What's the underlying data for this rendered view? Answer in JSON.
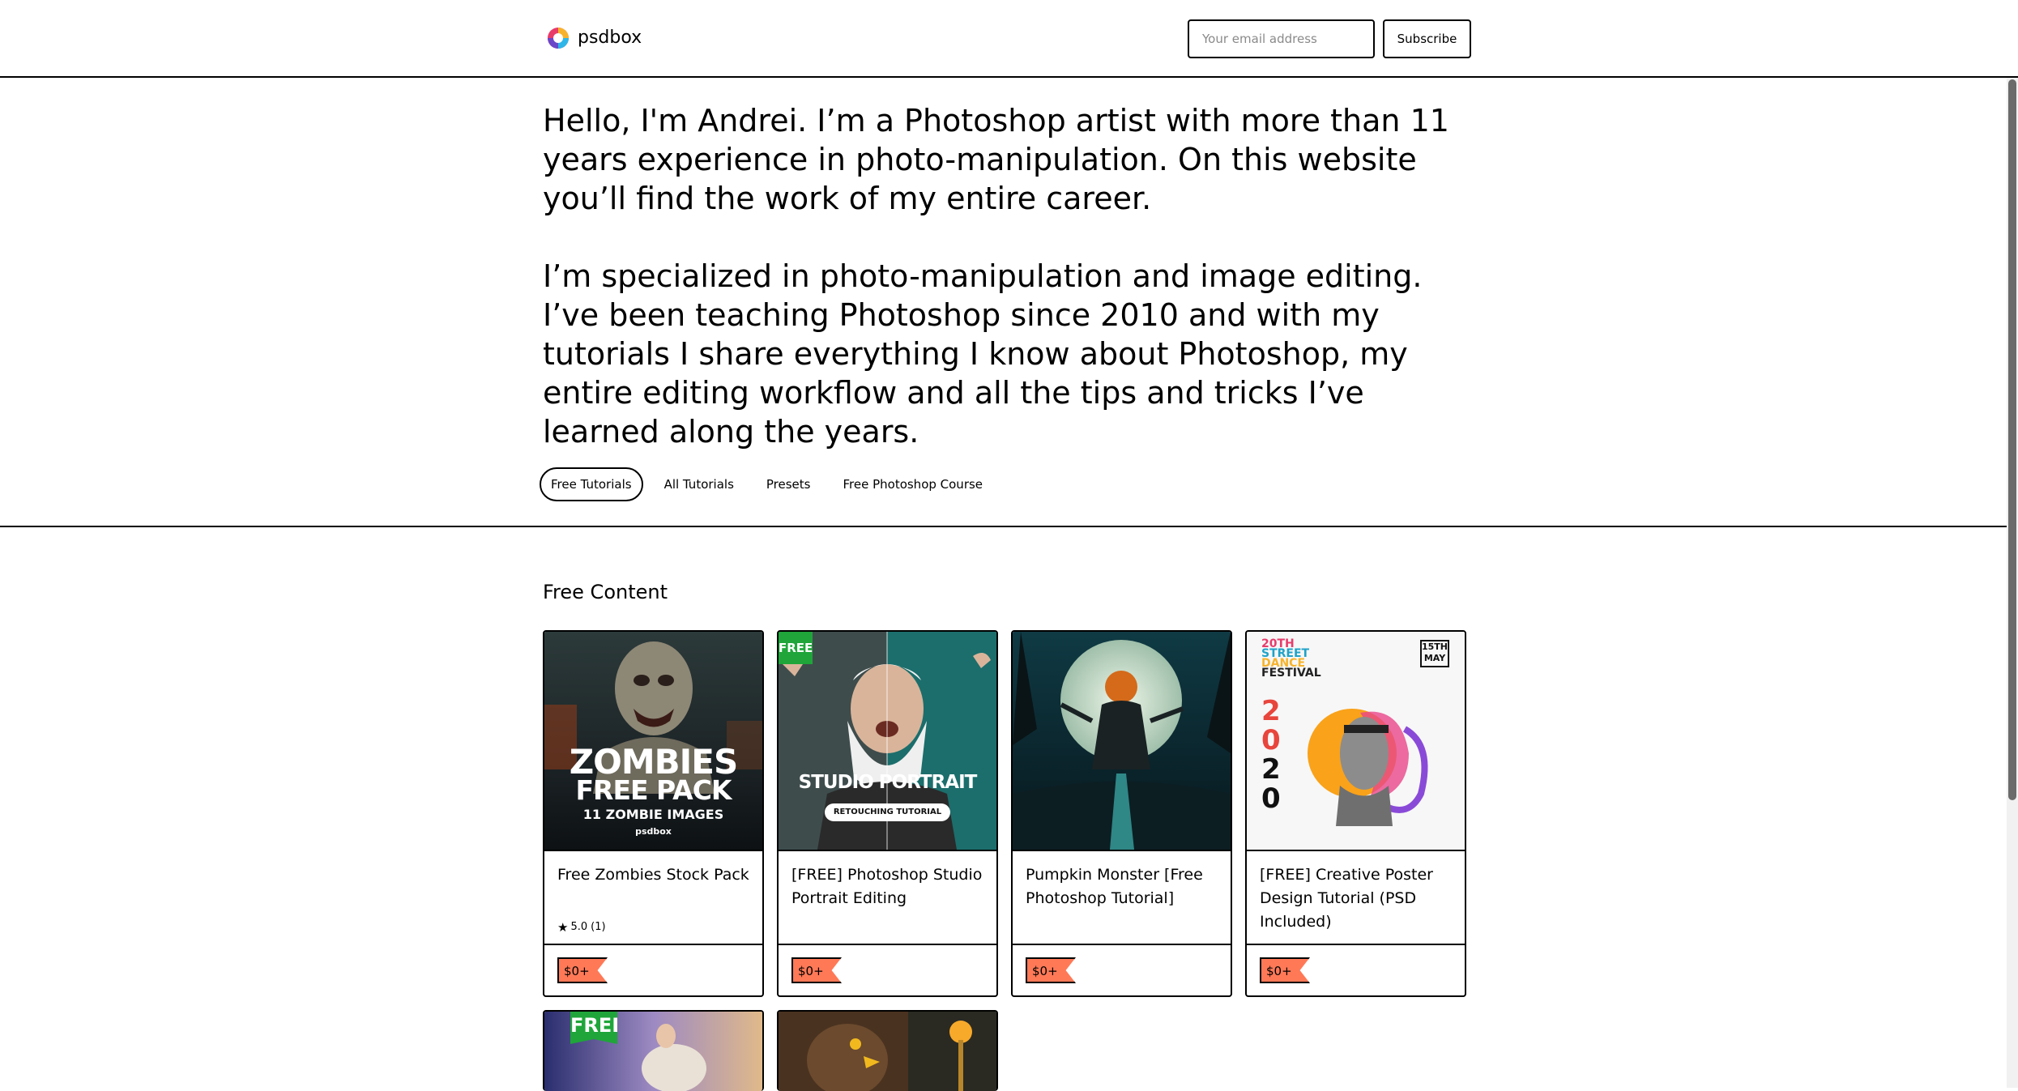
{
  "header": {
    "brand": "psdbox",
    "email_placeholder": "Your email address",
    "subscribe_label": "Subscribe"
  },
  "bio": {
    "paragraph1": "Hello, I'm Andrei. I’m a Photoshop artist with more than 11 years experience in photo-manipulation. On this website you’ll find the work of my entire career.",
    "paragraph2": "I’m specialized in photo-manipulation and image editing. I’ve been teaching Photoshop since 2010 and with my tutorials I share everything I know about Photoshop, my entire editing workflow and all the tips and tricks I’ve learned along the years."
  },
  "tabs": [
    {
      "label": "Free Tutorials",
      "active": true
    },
    {
      "label": "All Tutorials",
      "active": false
    },
    {
      "label": "Presets",
      "active": false
    },
    {
      "label": "Free Photoshop Course",
      "active": false
    }
  ],
  "section": {
    "title": "Free Content"
  },
  "products": [
    {
      "title": "Free Zombies Stock Pack",
      "rating": "5.0",
      "rating_count": "(1)",
      "price": "$0+",
      "thumb": {
        "headline1": "ZOMBIES",
        "headline2": "FREE PACK",
        "sub": "11 ZOMBIE IMAGES",
        "brand": "psdbox"
      }
    },
    {
      "title": "[FREE] Photoshop Studio Portrait Editing",
      "price": "$0+",
      "thumb": {
        "badge": "FREE",
        "headline": "STUDIO PORTRAIT",
        "sub": "RETOUCHING TUTORIAL"
      }
    },
    {
      "title": "Pumpkin Monster [Free Photoshop Tutorial]",
      "price": "$0+",
      "thumb": {}
    },
    {
      "title": "[FREE] Creative Poster Design Tutorial (PSD Included)",
      "price": "$0+",
      "thumb": {
        "line1": "20TH",
        "line2": "STREET",
        "line3": "DANCE",
        "line4": "FESTIVAL",
        "date_day": "15TH",
        "date_month": "MAY",
        "y1": "2",
        "y2": "0",
        "y3": "2",
        "y4": "0"
      }
    }
  ],
  "partial_products": [
    {
      "badge": "FREE"
    },
    {}
  ],
  "colors": {
    "price_tag": "#ff7957",
    "free_badge": "#1fa53a",
    "border": "#000000"
  }
}
